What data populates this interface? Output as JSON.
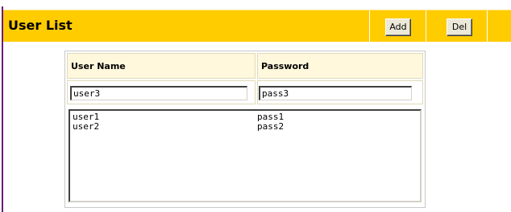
{
  "header": {
    "title": "User List",
    "add_label": "Add",
    "del_label": "Del"
  },
  "table": {
    "columns": [
      "User Name",
      "Password"
    ],
    "username_value": "user3",
    "password_value": "pass3",
    "rows": [
      {
        "user": "user1",
        "pass": "pass1"
      },
      {
        "user": "user2",
        "pass": "pass2"
      }
    ]
  },
  "colors": {
    "header_bg": "#ffcc00",
    "left_rule": "#6a1b7a",
    "column_header_bg": "#fff8dc"
  }
}
